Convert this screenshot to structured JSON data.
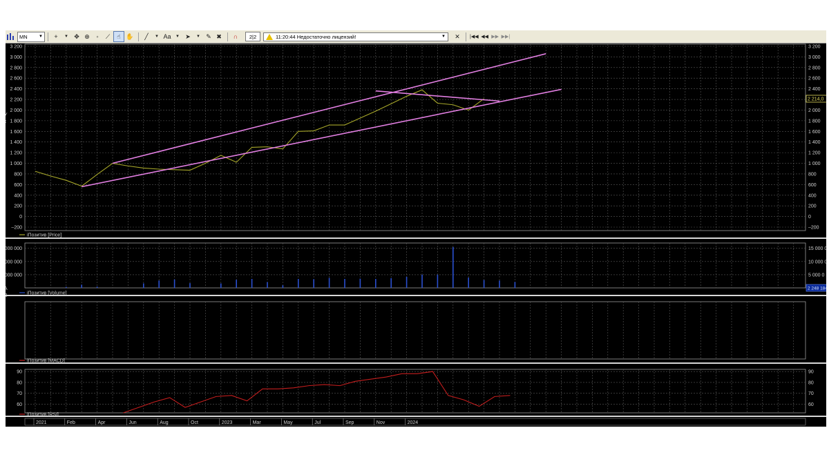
{
  "toolbar": {
    "timeframe": "MN",
    "page_indicator": "2|2",
    "message": "11:20:44  Недостаточно лицензий!",
    "font_label": "Aa"
  },
  "colors": {
    "background": "#000000",
    "grid": "#5a5a5a",
    "price_line": "#a8a82a",
    "channel_lines": "#e27fe2",
    "volume_bars": "#2a4fd0",
    "rsi_line": "#c41e1e",
    "axis_text": "#d0d0d0",
    "price_tag_border": "#e8e060"
  },
  "panes": {
    "price": {
      "legend": "iПозитив [Price]",
      "current_value": "2 214,0"
    },
    "volume": {
      "legend": "iПозитив [Volume]",
      "current_value": "2 248 184"
    },
    "macd": {
      "legend": "iПозитив [MACD]"
    },
    "rsi": {
      "legend": "iПозитив [RSI]"
    }
  },
  "left_stray_glyphs": [
    "У",
    "к",
    "А",
    "В"
  ],
  "chart_data": [
    {
      "type": "line",
      "pane": "price",
      "x": [
        "2021-01",
        "2021-02",
        "2021-03",
        "2021-04",
        "2021-05",
        "2021-06",
        "2021-07",
        "2021-08",
        "2021-09",
        "2021-10",
        "2021-11",
        "2021-12",
        "2022-01",
        "2022-02",
        "2022-03",
        "2022-04",
        "2022-05",
        "2022-06",
        "2022-07",
        "2022-08",
        "2022-09",
        "2022-10",
        "2022-11",
        "2022-12",
        "2023-01",
        "2023-02",
        "2023-03",
        "2023-04",
        "2023-05",
        "2023-06",
        "2023-07",
        "2023-08",
        "2023-09",
        "2023-10",
        "2023-11",
        "2023-12",
        "2024-01",
        "2024-02"
      ],
      "series": [
        {
          "values": [
            850,
            760,
            680,
            570,
            790,
            1000,
            950,
            910,
            890,
            880,
            870,
            1000,
            1150,
            1020,
            1300,
            1310,
            1270,
            1600,
            1610,
            1720,
            1720,
            1850,
            1980,
            2120,
            2260,
            2380,
            2130,
            2100,
            2000,
            2214
          ]
        }
      ],
      "channel_lines": [
        {
          "from": [
            "2021-04",
            560
          ],
          "to": [
            "2023-11",
            2390
          ]
        },
        {
          "from": [
            "2021-06",
            1000
          ],
          "to": [
            "2023-10",
            3060
          ]
        },
        {
          "from": [
            "2022-11",
            2360
          ],
          "to": [
            "2023-07",
            2170
          ]
        }
      ],
      "y_ticks": [
        -200,
        0,
        200,
        400,
        600,
        800,
        1000,
        1200,
        1400,
        1600,
        1800,
        2000,
        2200,
        2400,
        2600,
        2800,
        3000,
        3200
      ],
      "ylim": [
        -200,
        3200
      ]
    },
    {
      "type": "bar",
      "pane": "volume",
      "values": [
        0,
        0,
        400000,
        1200000,
        500000,
        0,
        0,
        1700000,
        2800000,
        3200000,
        1800000,
        0,
        1700000,
        3100000,
        3400000,
        2200000,
        1000000,
        3400000,
        3300000,
        3800000,
        3400000,
        3500000,
        3400000,
        3700000,
        4200000,
        5000000,
        5000000,
        15500000,
        3900000,
        3000000,
        2800000,
        2248184
      ],
      "y_ticks": [
        5000000,
        10000000,
        15000000
      ],
      "y_tick_labels_left": [
        "0 000 000",
        "000 000",
        "000 000"
      ],
      "y_tick_labels_right": [
        "15 000 0",
        "10 000 0",
        "5 000 0"
      ]
    },
    {
      "type": "line",
      "pane": "rsi",
      "series": [
        {
          "values": [
            null,
            null,
            null,
            null,
            null,
            null,
            52,
            57,
            62,
            66,
            57,
            62,
            67,
            68,
            63,
            74,
            74,
            75,
            77,
            78,
            77,
            81,
            83,
            85,
            88,
            88,
            90,
            68,
            64,
            58,
            67,
            68
          ]
        }
      ],
      "y_ticks": [
        60,
        70,
        80,
        90
      ],
      "ylim": [
        52,
        92
      ]
    }
  ],
  "x_axis": {
    "labels": [
      "2021",
      "Feb",
      "Apr",
      "Jun",
      "Aug",
      "Oct",
      "2023",
      "Mar",
      "May",
      "Jul",
      "Sep",
      "Nov",
      "2024"
    ]
  }
}
